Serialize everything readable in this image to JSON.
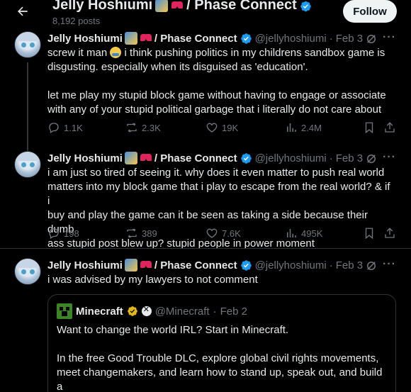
{
  "header": {
    "title_prefix": "Jelly Hoshiumi",
    "title_suffix": "/ Phase Connect",
    "posts_count": "8,192 posts",
    "follow_label": "Follow"
  },
  "posts": [
    {
      "name": "Jelly Hoshiumi",
      "name_suffix": "/ Phase Connect",
      "handle": "@jellyhoshiumi",
      "sep": "·",
      "date": "Feb 3",
      "text_a": "screw it man ",
      "text_b": " i think pushing politics in my childrens sandbox game is\ndisgusting. especially when its disguised as 'education'.\n\nlet me play my stupid block game without having to engage or associate\nwith any of your stupid political garbage that i literally do not care about",
      "replies": "1.1K",
      "reposts": "2.3K",
      "likes": "19K",
      "views": "2.4M"
    },
    {
      "name": "Jelly Hoshiumi",
      "name_suffix": "/ Phase Connect",
      "handle": "@jellyhoshiumi",
      "sep": "·",
      "date": "Feb 3",
      "text": "i am just so tired of seeing it. why does it even matter to push real world\nmatters into my block game that i play to escape from the real world? & if i\nbuy and play the game can it be seen as taking a side because their dumb\nass stupid post blew up? stupid people in power moment",
      "replies": "198",
      "reposts": "389",
      "likes": "7.6K",
      "views": "495K"
    },
    {
      "name": "Jelly Hoshiumi",
      "name_suffix": "/ Phase Connect",
      "handle": "@jellyhoshiumi",
      "sep": "·",
      "date": "Feb 3",
      "text": "i was advised by my lawyers to not comment"
    }
  ],
  "quote": {
    "name": "Minecraft",
    "handle": "@Minecraft",
    "sep": "·",
    "date": "Feb 2",
    "text": "Want to change the world IRL? Start in Minecraft.\n\nIn the free Good Trouble DLC, explore global civil rights movements,\nmeet changemakers, and learn how to stand up, speak out, and build a\nbetter world...."
  },
  "colors": {
    "background": "#000000",
    "text": "#e7e9ea",
    "muted": "#71767b",
    "verified_blue": "#1d9bf0",
    "verified_gold": "#e2b719",
    "border": "#2f3336"
  },
  "icons": [
    "back-arrow-icon",
    "verified-badge-icon",
    "grok-icon",
    "more-icon",
    "reply-icon",
    "repost-icon",
    "like-icon",
    "views-icon",
    "bookmark-icon",
    "share-icon",
    "minecraft-logo",
    "xbox-icon"
  ]
}
